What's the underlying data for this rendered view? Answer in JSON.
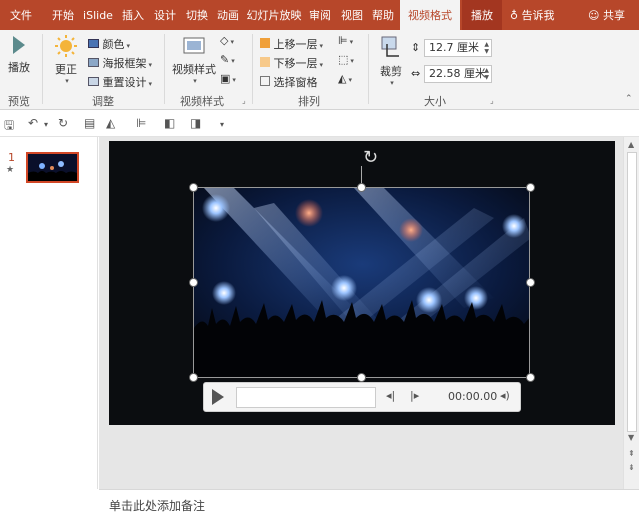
{
  "tabs": [
    "文件",
    "开始",
    "iSlide",
    "插入",
    "设计",
    "切换",
    "动画",
    "幻灯片放映",
    "审阅",
    "视图",
    "帮助",
    "视频格式",
    "播放"
  ],
  "active_tab": "视频格式",
  "tell_me": "告诉我",
  "share": "共享",
  "ribbon": {
    "preview": {
      "play_label": "播放",
      "group": "预览"
    },
    "adjust": {
      "correct_label": "更正",
      "color_label": "颜色",
      "poster_label": "海报框架",
      "reset_label": "重置设计",
      "group": "调整"
    },
    "video_styles": {
      "styles_label": "视频样式",
      "group": "视频样式"
    },
    "arrange": {
      "bring_forward": "上移一层",
      "send_backward": "下移一层",
      "selection_pane": "选择窗格",
      "group": "排列"
    },
    "size": {
      "crop_label": "裁剪",
      "height": "12.7 厘米",
      "width": "22.58 厘米",
      "group": "大小"
    }
  },
  "slides": [
    {
      "number": "1",
      "star": "★"
    }
  ],
  "video": {
    "timecode": "00:00.00"
  },
  "notes_placeholder": "单击此处添加备注",
  "colors": {
    "accent": "#b7472a",
    "active_tab_text": "#b7472a",
    "selection": "#d24726"
  },
  "icons": [
    "save-icon",
    "undo-icon",
    "redo-icon",
    "play-icon",
    "rewind-icon",
    "forward-icon",
    "volume-icon",
    "rotate-icon",
    "lightbulb-icon",
    "user-icon"
  ]
}
